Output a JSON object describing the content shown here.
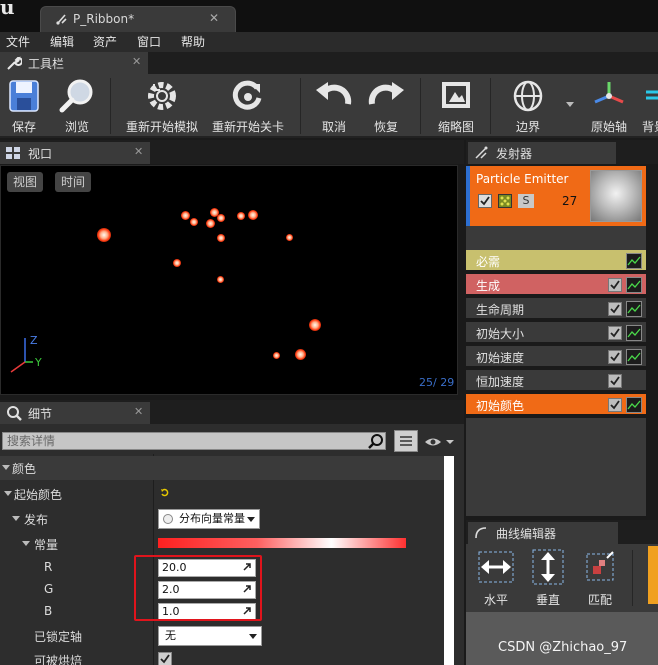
{
  "title_bar": {
    "logo": "u",
    "tab_label": "P_Ribbon*",
    "tab_close": "✕"
  },
  "menu": {
    "items": [
      "文件",
      "编辑",
      "资产",
      "窗口",
      "帮助"
    ]
  },
  "toolbar_panel": {
    "tab_label": "工具栏",
    "close": "✕"
  },
  "toolbar": {
    "buttons": [
      {
        "label": "保存",
        "icon": "save-icon"
      },
      {
        "label": "浏览",
        "icon": "browse-icon"
      },
      {
        "label": "重新开始模拟",
        "icon": "restart-sim-icon"
      },
      {
        "label": "重新开始关卡",
        "icon": "restart-level-icon"
      },
      {
        "label": "取消",
        "icon": "undo-icon"
      },
      {
        "label": "恢复",
        "icon": "redo-icon"
      },
      {
        "label": "缩略图",
        "icon": "thumbnail-icon"
      },
      {
        "label": "边界",
        "icon": "bounds-icon"
      },
      {
        "label": "原始轴",
        "icon": "origin-axis-icon"
      },
      {
        "label": "背景",
        "icon": "background-icon"
      }
    ]
  },
  "viewport": {
    "tab_label": "视口",
    "close": "✕",
    "view_button": "视图",
    "time_button": "时间",
    "particle_count": "25/  29",
    "axis": {
      "z": "Z",
      "y": "Y"
    }
  },
  "details": {
    "tab_label": "细节",
    "close": "✕",
    "search_placeholder": "搜索详情",
    "rows": {
      "color_category": "颜色",
      "initial_color": "起始颜色",
      "distribution": "发布",
      "distribution_value": "分布向量常量",
      "constant": "常量",
      "r_label": "R",
      "r_value": "20.0",
      "g_label": "G",
      "g_value": "2.0",
      "b_label": "B",
      "b_value": "1.0",
      "locked_axes": "已锁定轴",
      "locked_axes_value": "无",
      "can_be_baked": "可被烘焙"
    }
  },
  "emitters": {
    "tab_label": "发射器",
    "emitter_name": "Particle Emitter",
    "emitter_count": "27",
    "solo_label": "S",
    "modules": [
      "必需",
      "生成",
      "生命周期",
      "初始大小",
      "初始速度",
      "恒加速度",
      "初始颜色"
    ],
    "colors": {
      "card": "#f06a16",
      "required": "#c8c06e",
      "spawn": "#d06262",
      "default": "#3a3a3a",
      "selected": "#f06a16"
    }
  },
  "curve_editor": {
    "tab_label": "曲线编辑器",
    "buttons": [
      "水平",
      "垂直",
      "匹配"
    ]
  },
  "watermark": "CSDN @Zhichao_97"
}
